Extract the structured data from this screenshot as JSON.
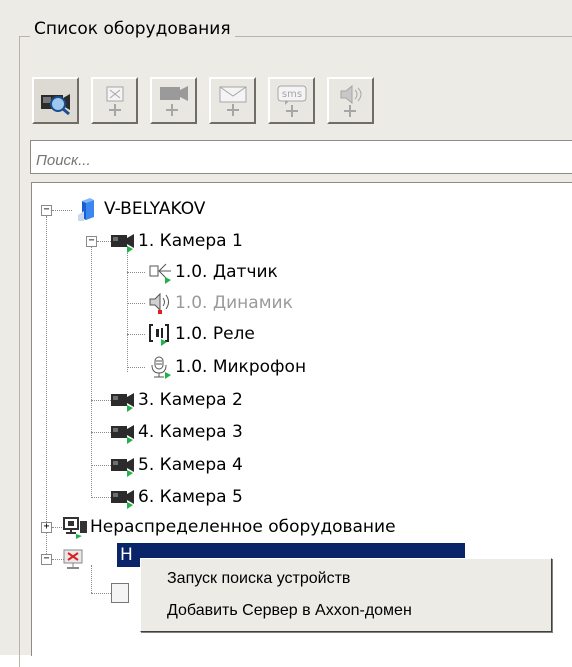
{
  "group_title": "Список оборудования",
  "toolbar": {
    "buttons": [
      {
        "icon": "camera-search-icon",
        "active": true
      },
      {
        "icon": "add-sensor-icon",
        "active": false
      },
      {
        "icon": "add-camera-icon",
        "active": false
      },
      {
        "icon": "add-email-icon",
        "active": false
      },
      {
        "icon": "add-sms-icon",
        "active": false
      },
      {
        "icon": "add-speaker-icon",
        "active": false
      }
    ]
  },
  "search": {
    "placeholder": "Поиск..."
  },
  "tree": {
    "server": {
      "label": "V-BELYAKOV",
      "expander": "−"
    },
    "camera1": {
      "label": "1. Камера 1",
      "expander": "−"
    },
    "sensor": {
      "label": "1.0. Датчик"
    },
    "speaker": {
      "label": "1.0. Динамик"
    },
    "relay": {
      "label": "1.0. Реле"
    },
    "mic": {
      "label": "1.0. Микрофон"
    },
    "camera2": {
      "label": "3. Камера 2"
    },
    "camera3": {
      "label": "4. Камера 3"
    },
    "camera4": {
      "label": "5. Камера 4"
    },
    "camera5": {
      "label": "6. Камера 5"
    },
    "unassigned": {
      "label": "Нераспределенное оборудование",
      "expander": "+"
    },
    "selected_partial": {
      "label": "Н",
      "expander": "−"
    }
  },
  "context_menu": {
    "items": [
      {
        "label": "Запуск поиска устройств"
      },
      {
        "label": "Добавить Сервер в Axxon-домен"
      }
    ]
  },
  "colors": {
    "selection": "#0a246a",
    "status_green": "#22b04a",
    "status_red": "#e02020",
    "server_blue": "#1a5fd0"
  }
}
